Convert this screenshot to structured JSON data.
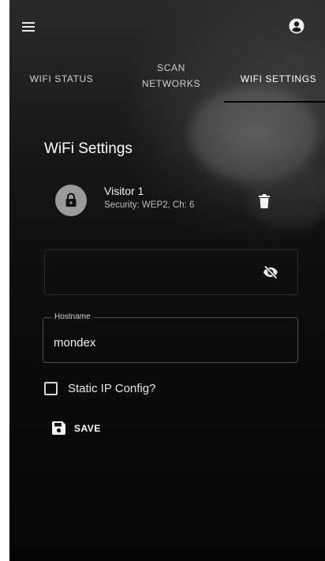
{
  "top_bar": {
    "menu_icon": "menu-icon",
    "account_icon": "account-circle-icon"
  },
  "tabs": [
    {
      "label": "WIFI STATUS",
      "active": false
    },
    {
      "label": "SCAN NETWORKS",
      "active": false
    },
    {
      "label": "WIFI SETTINGS",
      "active": true
    }
  ],
  "settings": {
    "title": "WiFi Settings",
    "network": {
      "name": "Visitor 1",
      "details": "Security: WEP2, Ch: 6",
      "icon": "lock-icon",
      "delete_icon": "trash-icon"
    },
    "password": {
      "value": "",
      "visibility_icon": "visibility-off-icon"
    },
    "hostname": {
      "label": "Hostname",
      "value": "mondex"
    },
    "static_ip": {
      "label": "Static IP Config?",
      "checked": false
    },
    "save": {
      "label": "SAVE",
      "icon": "floppy-disk-icon"
    }
  },
  "colors": {
    "background": "#0c0c0c",
    "text": "#ffffff",
    "secondary_text": "#bdbdbd",
    "lock_circle": "#9a9a9a"
  }
}
